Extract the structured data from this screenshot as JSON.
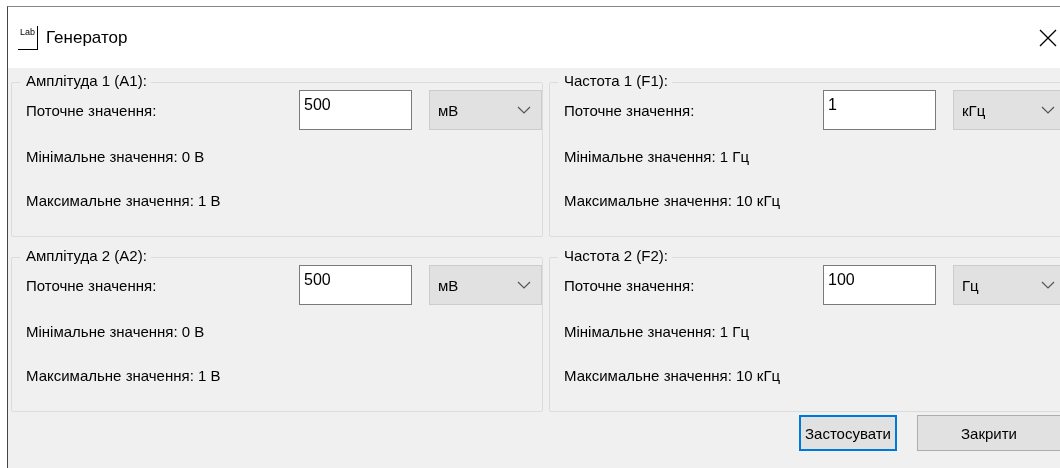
{
  "window": {
    "icon_text": "Lab",
    "title": "Генератор"
  },
  "groups": [
    {
      "legend": "Амплітуда 1 (A1):",
      "current_label": "Поточне значення:",
      "value": "500",
      "unit": "мВ",
      "min": "Мінімальне значення: 0 В",
      "max": "Максимальне значення: 1 В"
    },
    {
      "legend": "Частота 1 (F1):",
      "current_label": "Поточне значення:",
      "value": "1",
      "unit": "кГц",
      "min": "Мінімальне значення: 1 Гц",
      "max": "Максимальне значення: 10 кГц"
    },
    {
      "legend": "Амплітуда 2 (A2):",
      "current_label": "Поточне значення:",
      "value": "500",
      "unit": "мВ",
      "min": "Мінімальне значення: 0 В",
      "max": "Максимальне значення: 1 В"
    },
    {
      "legend": "Частота 2 (F2):",
      "current_label": "Поточне значення:",
      "value": "100",
      "unit": "Гц",
      "min": "Мінімальне значення: 1 Гц",
      "max": "Максимальне значення: 10 кГц"
    }
  ],
  "buttons": [
    {
      "label": "Застосувати",
      "focused": true
    },
    {
      "label": "Закрити",
      "focused": false
    }
  ]
}
